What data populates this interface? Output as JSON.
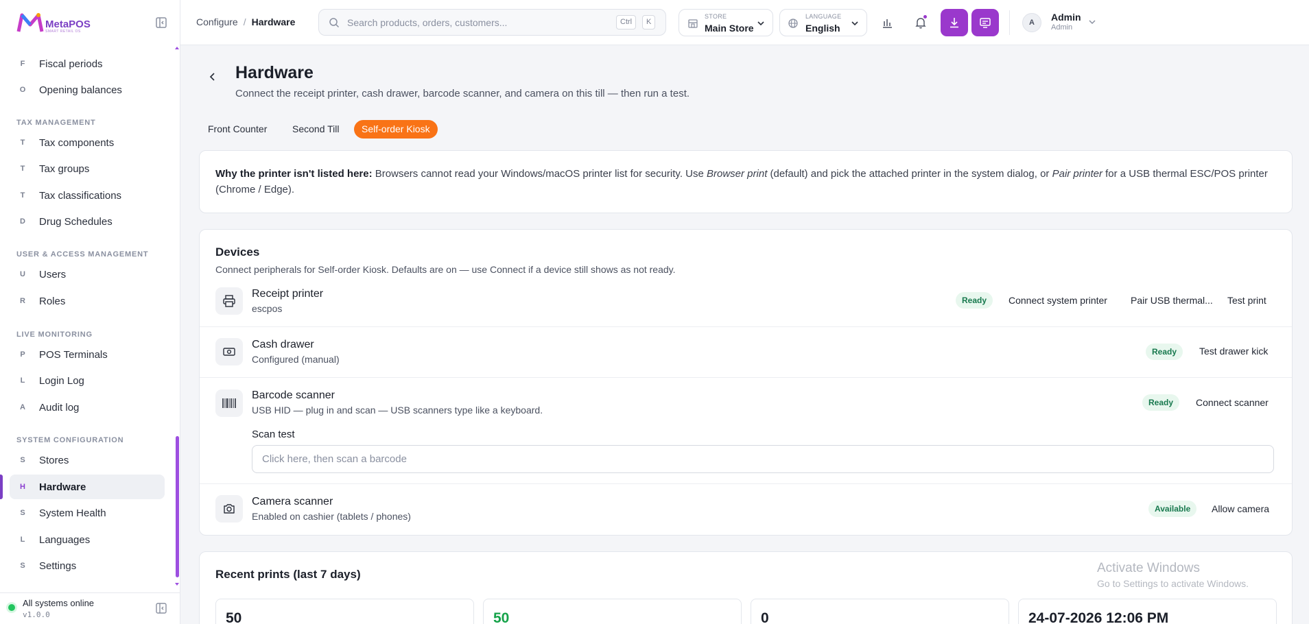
{
  "brand": {
    "name": "MetaPOS",
    "tagline": "SMART RETAIL OS"
  },
  "sidebar": {
    "sections": [
      {
        "label": "Tax Management"
      },
      {
        "label": "User & Access Management"
      },
      {
        "label": "Live Monitoring"
      },
      {
        "label": "System Configuration"
      }
    ],
    "items": [
      {
        "abbr": "F",
        "label": "Fiscal periods"
      },
      {
        "abbr": "O",
        "label": "Opening balances"
      },
      {
        "abbr": "T",
        "label": "Tax components"
      },
      {
        "abbr": "T",
        "label": "Tax groups"
      },
      {
        "abbr": "T",
        "label": "Tax classifications"
      },
      {
        "abbr": "D",
        "label": "Drug Schedules"
      },
      {
        "abbr": "U",
        "label": "Users"
      },
      {
        "abbr": "R",
        "label": "Roles"
      },
      {
        "abbr": "P",
        "label": "POS Terminals"
      },
      {
        "abbr": "L",
        "label": "Login Log"
      },
      {
        "abbr": "A",
        "label": "Audit log"
      },
      {
        "abbr": "S",
        "label": "Stores"
      },
      {
        "abbr": "H",
        "label": "Hardware"
      },
      {
        "abbr": "S",
        "label": "System Health"
      },
      {
        "abbr": "L",
        "label": "Languages"
      },
      {
        "abbr": "S",
        "label": "Settings"
      }
    ],
    "active_item": "Hardware",
    "footer": {
      "status": "All systems online",
      "version": "v1.0.0"
    }
  },
  "topbar": {
    "breadcrumb": {
      "parent": "Configure",
      "current": "Hardware",
      "separator": "/"
    },
    "search": {
      "placeholder": "Search products, orders, customers...",
      "key1": "Ctrl",
      "key2": "K"
    },
    "store": {
      "caption": "STORE",
      "value": "Main Store"
    },
    "language": {
      "caption": "LANGUAGE",
      "value": "English"
    },
    "user": {
      "initial": "A",
      "name": "Admin",
      "role": "Admin"
    }
  },
  "page": {
    "title": "Hardware",
    "subtitle": "Connect the receipt printer, cash drawer, barcode scanner, and camera on this till — then run a test.",
    "tabs": [
      {
        "label": "Front Counter"
      },
      {
        "label": "Second Till"
      },
      {
        "label": "Self-order Kiosk"
      }
    ],
    "active_tab": "Self-order Kiosk",
    "info": {
      "lead": "Why the printer isn't listed here:",
      "p1": " Browsers cannot read your Windows/macOS printer list for security. Use ",
      "em1": "Browser print",
      "p2": " (default) and pick the attached printer in the system dialog, or ",
      "em2": "Pair printer",
      "p3": " for a USB thermal ESC/POS printer (Chrome / Edge)."
    },
    "devices": {
      "title": "Devices",
      "subtitle": "Connect peripherals for Self-order Kiosk. Defaults are on — use Connect if a device still shows as not ready.",
      "receipt_printer": {
        "name": "Receipt printer",
        "desc": "escpos",
        "status": "Ready",
        "actions": [
          "Connect system printer",
          "Pair USB thermal...",
          "Test print"
        ]
      },
      "cash_drawer": {
        "name": "Cash drawer",
        "desc": "Configured (manual)",
        "status": "Ready",
        "actions": [
          "Test drawer kick"
        ]
      },
      "barcode_scanner": {
        "name": "Barcode scanner",
        "desc": "USB HID — plug in and scan — USB scanners type like a keyboard.",
        "status": "Ready",
        "actions": [
          "Connect scanner"
        ],
        "scan_test_label": "Scan test",
        "scan_placeholder": "Click here, then scan a barcode"
      },
      "camera_scanner": {
        "name": "Camera scanner",
        "desc": "Enabled on cashier (tablets / phones)",
        "status": "Available",
        "actions": [
          "Allow camera"
        ]
      }
    },
    "recent_prints": {
      "title": "Recent prints (last 7 days)",
      "stats": [
        "50",
        "50",
        "0",
        "24-07-2026 12:06 PM"
      ]
    }
  },
  "watermark": {
    "line1": "Activate Windows",
    "line2": "Go to Settings to activate Windows."
  },
  "colors": {
    "accent": "#9a38cc",
    "tab_active": "#f97316",
    "ready_bg": "#e8f7ee",
    "ready_text": "#18794e"
  }
}
